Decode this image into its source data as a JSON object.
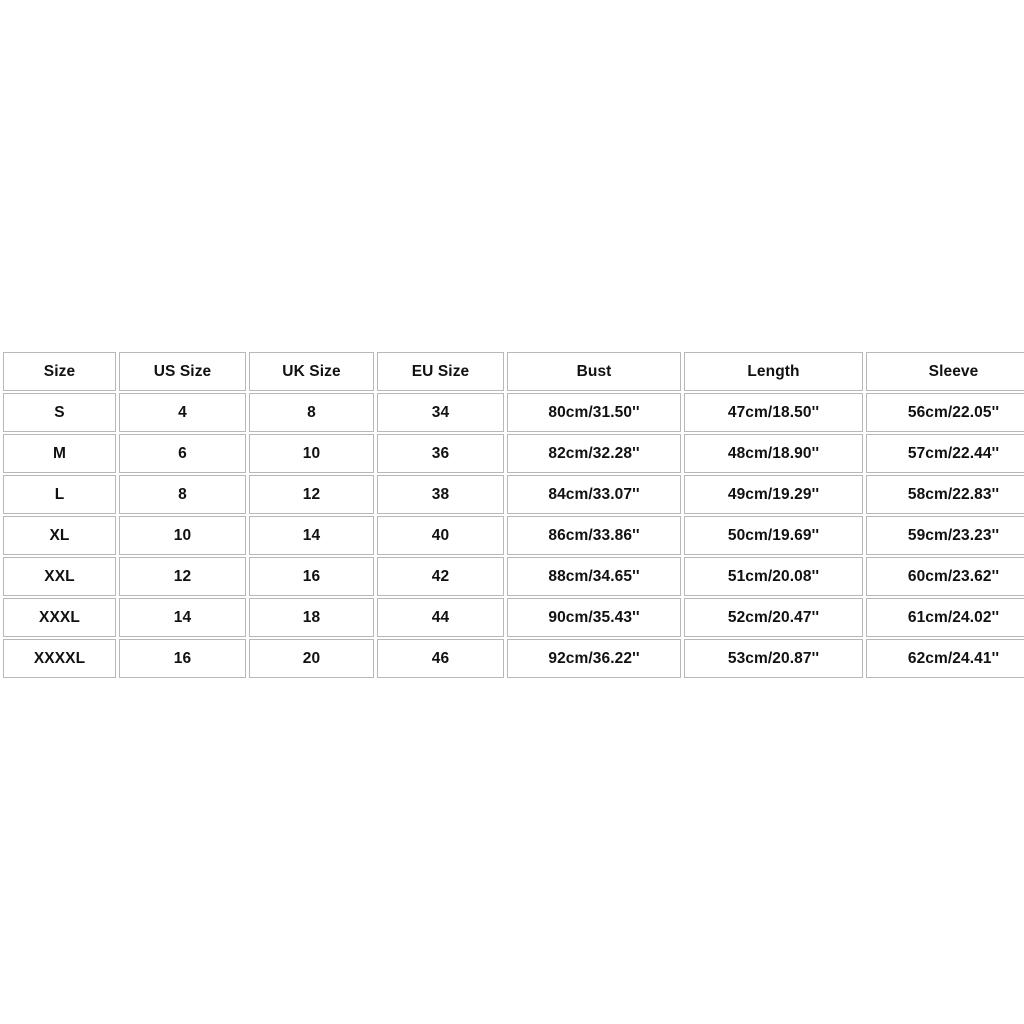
{
  "page": {
    "background_color": "#ffffff",
    "text_color": "#111111",
    "cell_border_color": "#b8b8b8"
  },
  "size_chart": {
    "columns": [
      "Size",
      "US Size",
      "UK Size",
      "EU Size",
      "Bust",
      "Length",
      "Sleeve"
    ],
    "rows": [
      {
        "size": "S",
        "us_size": "4",
        "uk_size": "8",
        "eu_size": "34",
        "bust": "80cm/31.50''",
        "length": "47cm/18.50''",
        "sleeve": "56cm/22.05''"
      },
      {
        "size": "M",
        "us_size": "6",
        "uk_size": "10",
        "eu_size": "36",
        "bust": "82cm/32.28''",
        "length": "48cm/18.90''",
        "sleeve": "57cm/22.44''"
      },
      {
        "size": "L",
        "us_size": "8",
        "uk_size": "12",
        "eu_size": "38",
        "bust": "84cm/33.07''",
        "length": "49cm/19.29''",
        "sleeve": "58cm/22.83''"
      },
      {
        "size": "XL",
        "us_size": "10",
        "uk_size": "14",
        "eu_size": "40",
        "bust": "86cm/33.86''",
        "length": "50cm/19.69''",
        "sleeve": "59cm/23.23''"
      },
      {
        "size": "XXL",
        "us_size": "12",
        "uk_size": "16",
        "eu_size": "42",
        "bust": "88cm/34.65''",
        "length": "51cm/20.08''",
        "sleeve": "60cm/23.62''"
      },
      {
        "size": "XXXL",
        "us_size": "14",
        "uk_size": "18",
        "eu_size": "44",
        "bust": "90cm/35.43''",
        "length": "52cm/20.47''",
        "sleeve": "61cm/24.02''"
      },
      {
        "size": "XXXXL",
        "us_size": "16",
        "uk_size": "20",
        "eu_size": "46",
        "bust": "92cm/36.22''",
        "length": "53cm/20.87''",
        "sleeve": "62cm/24.41''"
      }
    ]
  }
}
